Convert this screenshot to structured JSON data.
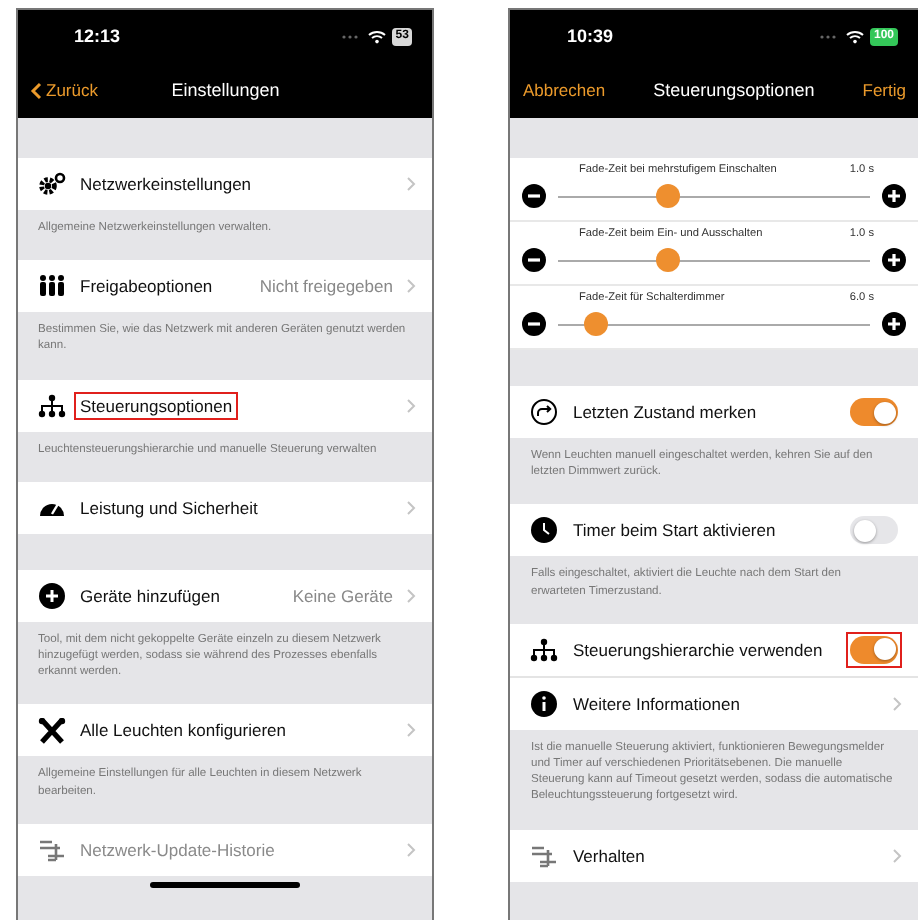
{
  "screens": [
    {
      "status_bar": {
        "time": "12:13",
        "battery": "53",
        "charging": false
      },
      "nav": {
        "kind": "back",
        "left": "Zurück",
        "title": "Einstellungen"
      },
      "sections": [
        {
          "rows": [
            {
              "kind": "link",
              "label": "Netzwerkeinstellungen",
              "highlighted": false,
              "disabled": false
            }
          ],
          "footer": "Allgemeine Netzwerkeinstellungen verwalten."
        },
        {
          "rows": [
            {
              "kind": "link",
              "label": "Freigabeoptionen",
              "value": "Nicht freigegeben",
              "highlighted": false,
              "disabled": false
            }
          ],
          "footer": "Bestimmen Sie, wie das Netzwerk mit anderen Geräten genutzt werden kann."
        },
        {
          "rows": [
            {
              "kind": "link",
              "label": "Steuerungsoptionen",
              "highlighted": true,
              "disabled": false
            }
          ],
          "footer": "Leuchtensteuerungshierarchie und manuelle Steuerung verwalten"
        },
        {
          "rows": [
            {
              "kind": "link",
              "label": "Leistung und Sicherheit",
              "highlighted": false,
              "disabled": false
            }
          ]
        },
        {
          "rows": [
            {
              "kind": "link",
              "label": "Geräte hinzufügen",
              "value": "Keine Geräte",
              "highlighted": false,
              "disabled": false
            }
          ],
          "footer": "Tool, mit dem nicht gekoppelte Geräte einzeln zu diesem Netzwerk hinzugefügt werden, sodass sie während des Prozesses ebenfalls erkannt werden."
        },
        {
          "rows": [
            {
              "kind": "link",
              "label": "Alle Leuchten konfigurieren",
              "highlighted": false,
              "disabled": false
            }
          ],
          "footer": "Allgemeine Einstellungen für alle Leuchten in diesem Netzwerk bearbeiten."
        },
        {
          "rows": [
            {
              "kind": "link",
              "label": "Netzwerk-Update-Historie",
              "highlighted": false,
              "disabled": true
            }
          ]
        }
      ]
    },
    {
      "status_bar": {
        "time": "10:39",
        "battery": "100",
        "charging": true
      },
      "nav": {
        "kind": "modal",
        "left": "Abbrechen",
        "title": "Steuerungsoptionen",
        "right": "Fertig"
      },
      "sections": [
        {
          "rows": [
            {
              "kind": "slider",
              "label": "Fade-Zeit bei mehrstufigem Einschalten",
              "reading": "1.0 s",
              "level": 0.35
            },
            {
              "kind": "slider",
              "label": "Fade-Zeit beim Ein- und Ausschalten",
              "reading": "1.0 s",
              "level": 0.35
            },
            {
              "kind": "slider",
              "label": "Fade-Zeit für Schalterdimmer",
              "reading": "6.0 s",
              "level": 0.12
            }
          ]
        },
        {
          "rows": [
            {
              "kind": "toggle",
              "label": "Letzten Zustand merken",
              "on": true,
              "highlighted": false
            }
          ],
          "footer": "Wenn Leuchten manuell eingeschaltet werden, kehren Sie auf den letzten Dimmwert zurück."
        },
        {
          "rows": [
            {
              "kind": "toggle",
              "label": "Timer beim Start aktivieren",
              "on": false,
              "highlighted": false
            }
          ],
          "footer": "Falls eingeschaltet, aktiviert die Leuchte nach dem Start den erwarteten Timerzustand."
        },
        {
          "rows": [
            {
              "kind": "toggle",
              "label": "Steuerungshierarchie verwenden",
              "on": true,
              "highlighted": true
            },
            {
              "kind": "link",
              "label": "Weitere Informationen",
              "highlighted": false,
              "disabled": false
            }
          ],
          "footer": "Ist die manuelle Steuerung aktiviert, funktionieren Bewegungsmelder und Timer auf verschiedenen Prioritätsebenen. Die manuelle Steuerung kann auf Timeout gesetzt werden, sodass die automatische Beleuchtungssteuerung fortgesetzt wird."
        },
        {
          "rows": [
            {
              "kind": "link",
              "label": "Verhalten",
              "highlighted": false,
              "disabled": false
            }
          ]
        }
      ]
    }
  ]
}
